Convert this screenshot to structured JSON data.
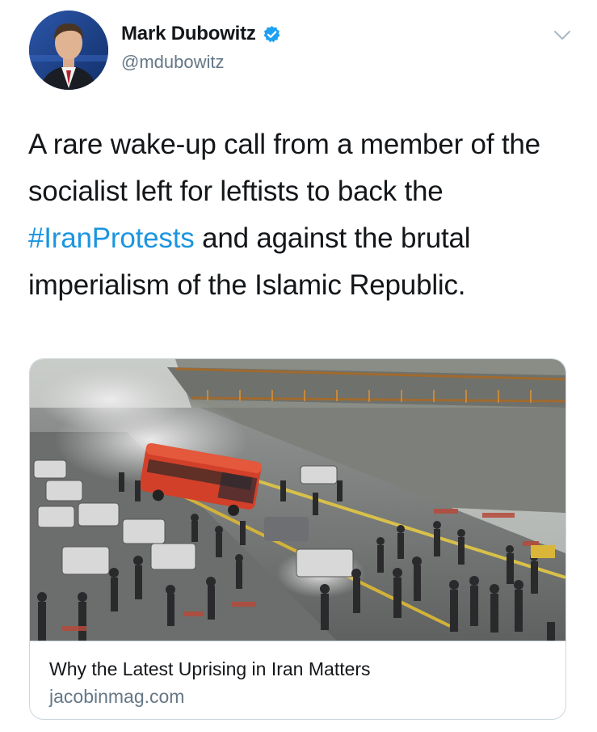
{
  "tweet": {
    "author": {
      "display_name": "Mark Dubowitz",
      "handle": "@mdubowitz",
      "verified": true,
      "avatar_icon": "profile-photo"
    },
    "menu_icon": "chevron-down-icon",
    "text_parts": [
      "A rare wake-up call from a member of the socialist left for leftists to back the ",
      "#IranProtests",
      " and against the brutal imperialism of the Islamic Republic."
    ],
    "hashtag_color": "#1b95e0"
  },
  "card": {
    "image_alt": "Street protest scene with bus, cars and tear gas smoke",
    "title": "Why the Latest Uprising in Iran Matters",
    "domain": "jacobinmag.com"
  },
  "colors": {
    "verified_blue": "#1da1f2",
    "text_primary": "#14171a",
    "text_secondary": "#657786",
    "border": "#ccd6dd"
  }
}
